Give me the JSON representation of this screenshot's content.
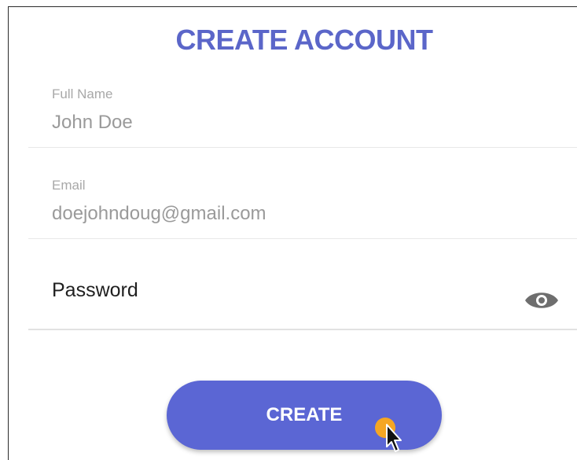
{
  "header": {
    "title": "CREATE ACCOUNT"
  },
  "form": {
    "full_name": {
      "label": "Full Name",
      "value": "John Doe"
    },
    "email": {
      "label": "Email",
      "value": "doejohndoug@gmail.com"
    },
    "password": {
      "placeholder": "Password",
      "toggle_icon": "eye-icon"
    }
  },
  "actions": {
    "create_label": "CREATE"
  },
  "colors": {
    "accent": "#5b66d4",
    "title": "#5b66c9",
    "click_indicator": "#f5a623"
  }
}
